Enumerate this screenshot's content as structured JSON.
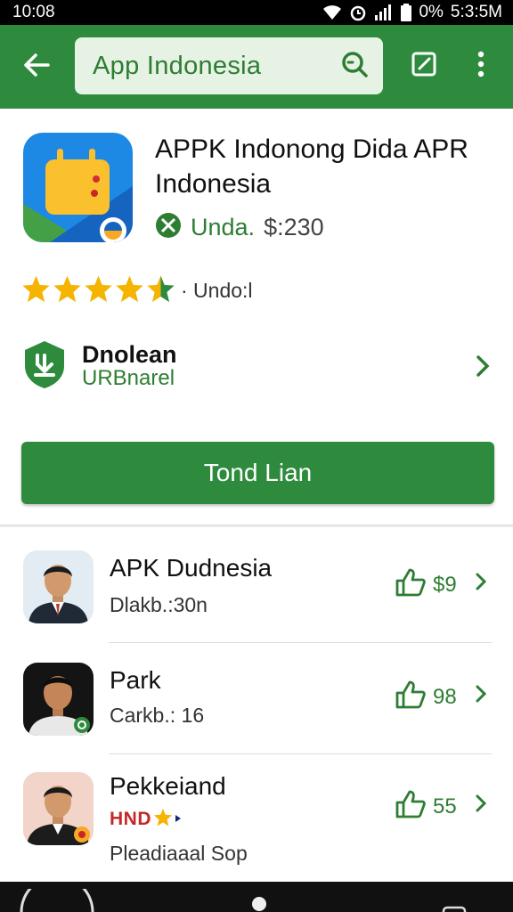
{
  "status_bar": {
    "time": "10:08",
    "battery_text": "0%",
    "clock_right": "5:3:5M"
  },
  "app_bar": {
    "search_value": "App  Indonesia",
    "icons": [
      "back-arrow-icon",
      "search-icon",
      "edit-icon",
      "more-vert-icon"
    ]
  },
  "app_detail": {
    "title": "APPK Indonong Dida APR Indonesia",
    "meta_label": "Unda.",
    "meta_price": "$:230",
    "rating_stars": 4.5,
    "rating_text": "· Undo:l",
    "developer": {
      "name": "Dnolean",
      "subtitle": "URBnarel"
    },
    "install_label": "Tond Lian"
  },
  "list": {
    "items": [
      {
        "title": "APK Dudnesia",
        "subtitle": "Dlakb.:30n",
        "count": "$9"
      },
      {
        "title": "Park",
        "subtitle": "Carkb.: 16",
        "count": "98"
      },
      {
        "title": "Pekkeiand",
        "badge": "HND",
        "subtitle": "Pleadiaaal Sop",
        "count": "55"
      }
    ]
  },
  "colors": {
    "accent": "#2e8b3e",
    "accent_text": "#2e7d32",
    "star": "#f5b400"
  }
}
